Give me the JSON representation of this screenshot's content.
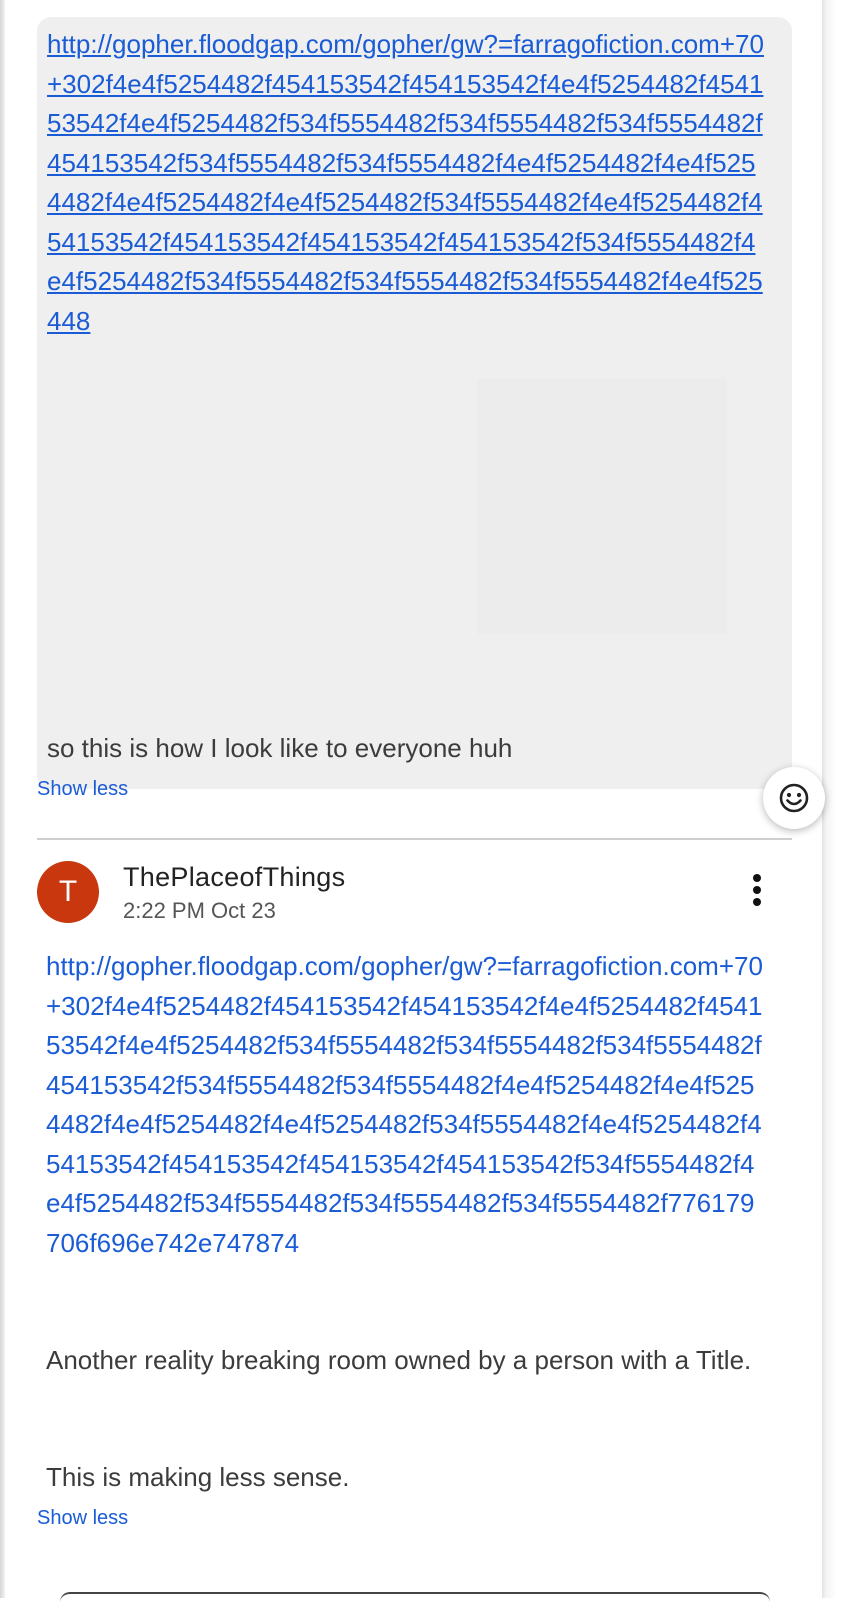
{
  "message1": {
    "link": "http://gopher.floodgap.com/gopher/gw?=farragofiction.com+70+302f4e4f5254482f454153542f454153542f4e4f5254482f454153542f4e4f5254482f534f5554482f534f5554482f534f5554482f454153542f534f5554482f534f5554482f4e4f5254482f4e4f5254482f4e4f5254482f4e4f5254482f534f5554482f4e4f5254482f454153542f454153542f454153542f454153542f534f5554482f4e4f5254482f534f5554482f534f5554482f534f5554482f4e4f525448",
    "caption": "so this is how I look like to everyone huh",
    "show_less": "Show less"
  },
  "emoji_button": {
    "icon": "smiley-icon"
  },
  "post2": {
    "avatar_letter": "T",
    "avatar_color": "#c9370f",
    "author": "ThePlaceofThings",
    "timestamp": "2:22 PM Oct 23",
    "link": "http://gopher.floodgap.com/gopher/gw?=farragofiction.com+70+302f4e4f5254482f454153542f454153542f4e4f5254482f454153542f4e4f5254482f534f5554482f534f5554482f534f5554482f454153542f534f5554482f534f5554482f4e4f5254482f4e4f5254482f4e4f5254482f4e4f5254482f534f5554482f4e4f5254482f454153542f454153542f454153542f454153542f534f5554482f4e4f5254482f534f5554482f534f5554482f534f5554482f776179706f696e742e747874",
    "paragraph1": "Another reality breaking room owned by a person with a Title.",
    "paragraph2": "This is making less sense.",
    "show_less": "Show less",
    "menu_icon": "more-vert-icon"
  },
  "colors": {
    "link": "#1a5bd6",
    "bubble_bg": "#efefef"
  }
}
